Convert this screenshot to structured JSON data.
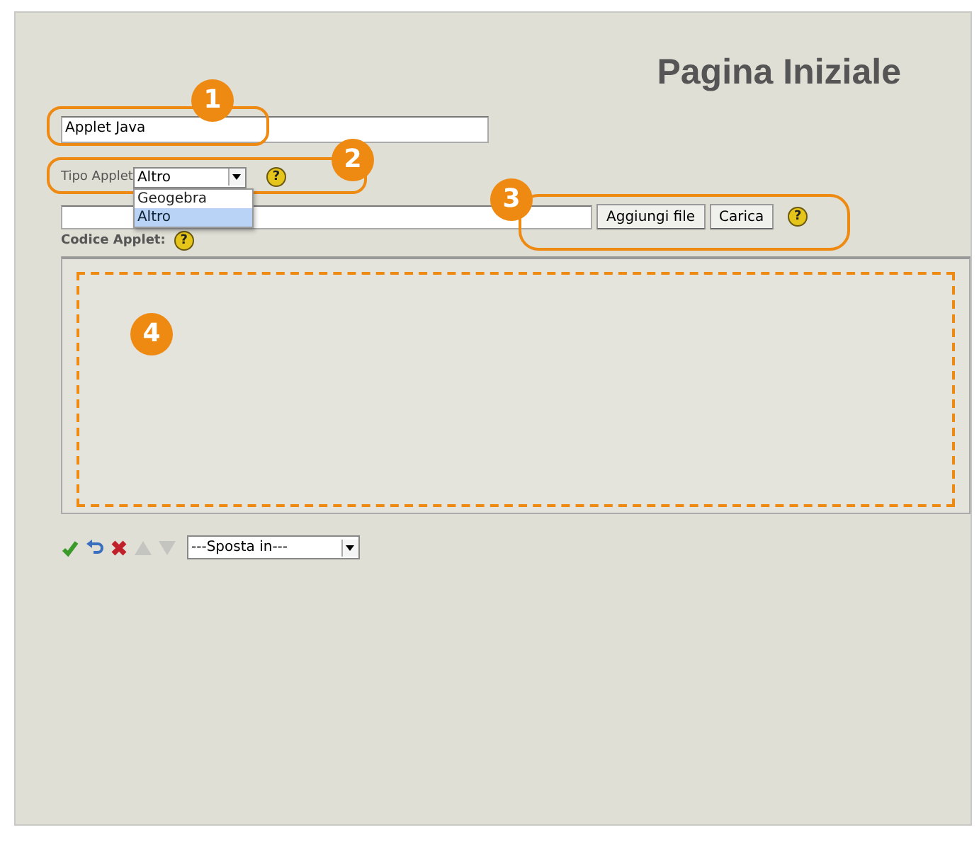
{
  "title": "Pagina Iniziale",
  "name_field": {
    "value": "Applet Java"
  },
  "applet_type": {
    "label": "Tipo Applet",
    "value": "Altro",
    "help": "?",
    "expanded": true,
    "options": [
      {
        "label": "Geogebra",
        "selected": false
      },
      {
        "label": "Altro",
        "selected": true
      }
    ]
  },
  "file_row": {
    "buttons": [
      "Aggiungi file",
      "Carica"
    ],
    "help": "?"
  },
  "code": {
    "label": "Codice Applet:",
    "help": "?"
  },
  "toolbar": {
    "move_select": "---Sposta in---"
  },
  "callouts": [
    {
      "number": "1"
    },
    {
      "number": "2"
    },
    {
      "number": "3"
    },
    {
      "number": "4"
    }
  ]
}
